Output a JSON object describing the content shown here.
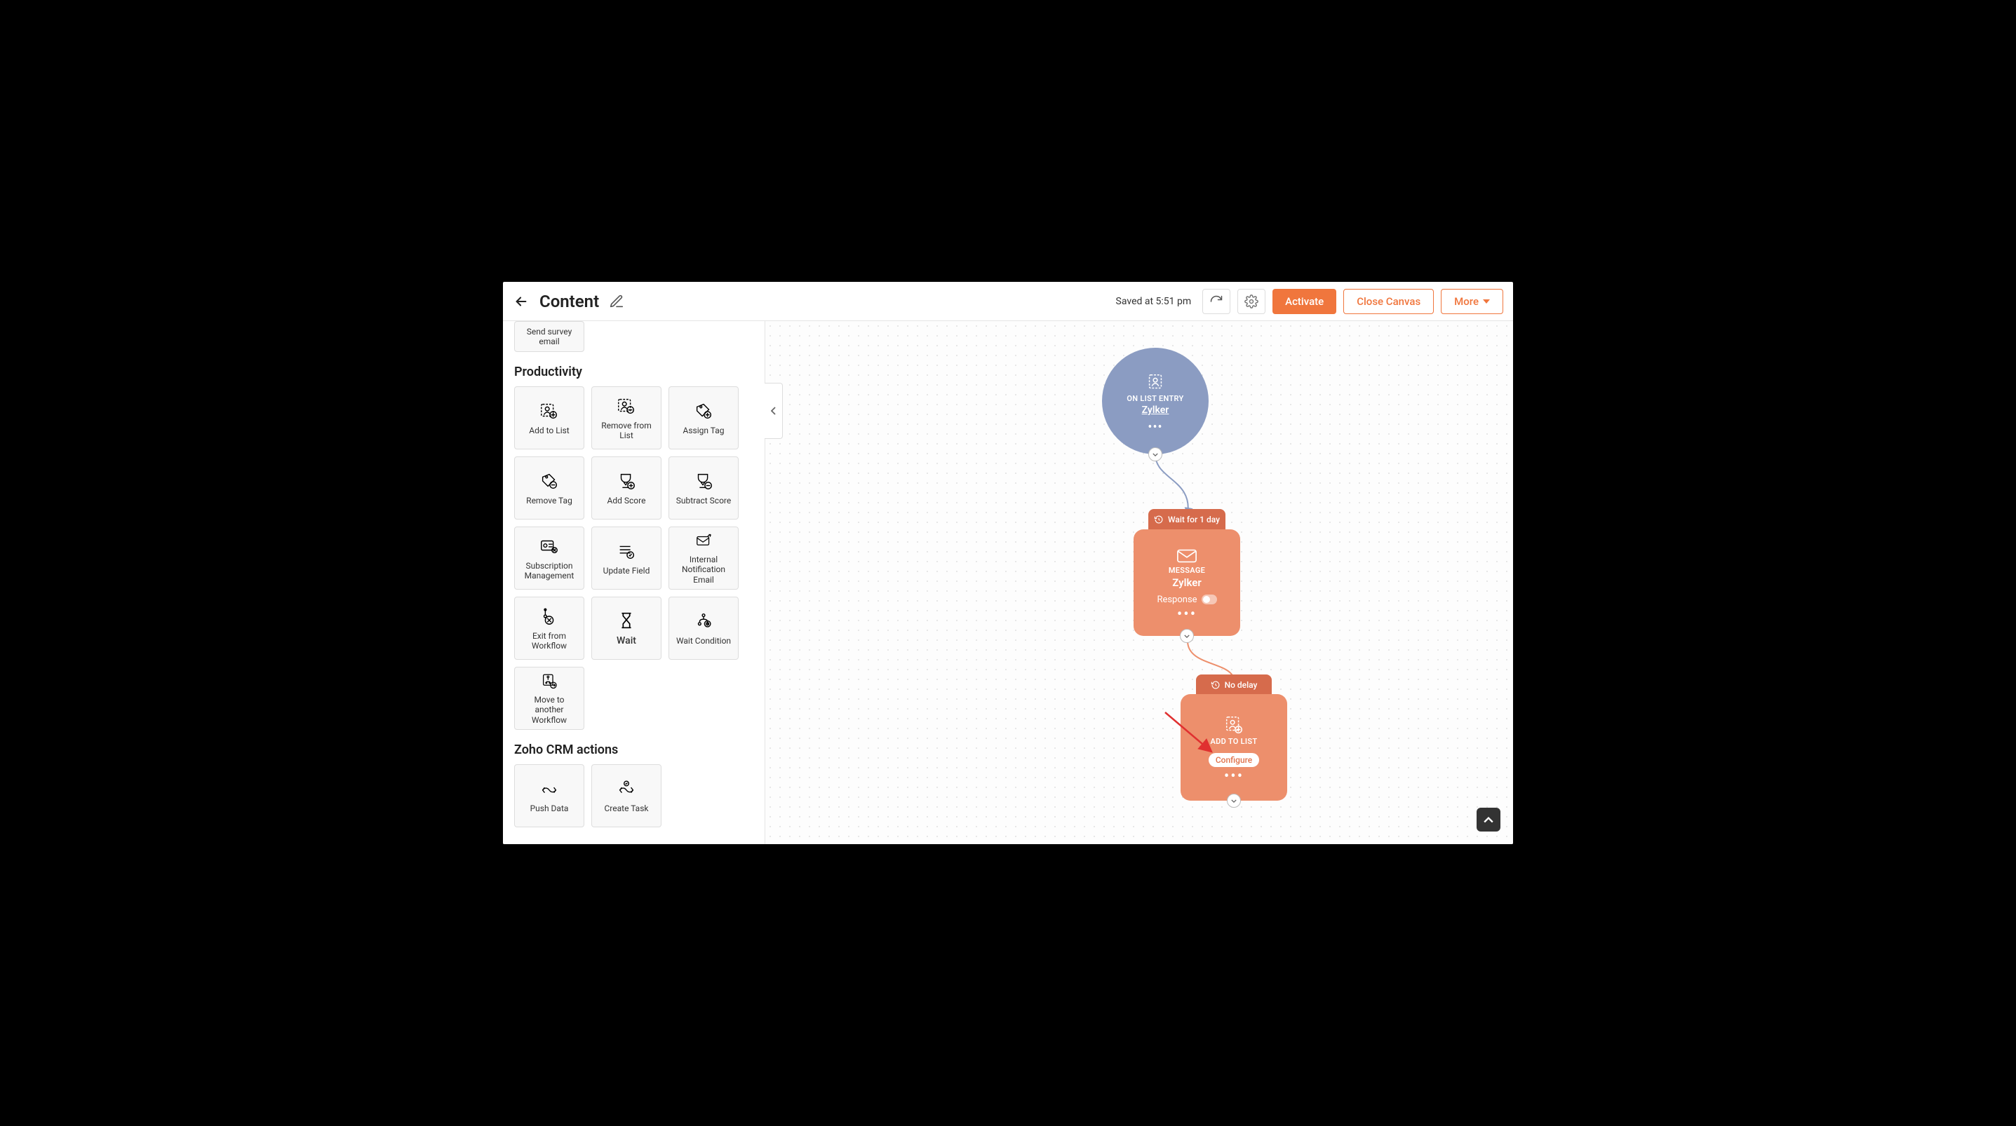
{
  "header": {
    "title": "Content",
    "saved": "Saved at 5:51 pm",
    "activate": "Activate",
    "close": "Close Canvas",
    "more": "More"
  },
  "sidebar": {
    "top_block": "Send survey email",
    "section_productivity": "Productivity",
    "section_crm": "Zoho CRM actions",
    "productivity": [
      "Add to List",
      "Remove from List",
      "Assign Tag",
      "Remove Tag",
      "Add Score",
      "Subtract Score",
      "Subscription Management",
      "Update Field",
      "Internal Notification Email",
      "Exit from Workflow",
      "Wait",
      "Wait Condition",
      "Move to another Workflow"
    ],
    "crm": [
      "Push Data",
      "Create Task"
    ]
  },
  "canvas": {
    "trigger": {
      "kind": "ON LIST ENTRY",
      "name": "Zylker"
    },
    "msg": {
      "delay": "Wait for 1 day",
      "kind": "MESSAGE",
      "name": "Zylker",
      "response": "Response"
    },
    "add": {
      "delay": "No delay",
      "kind": "ADD TO LIST",
      "configure": "Configure"
    }
  }
}
